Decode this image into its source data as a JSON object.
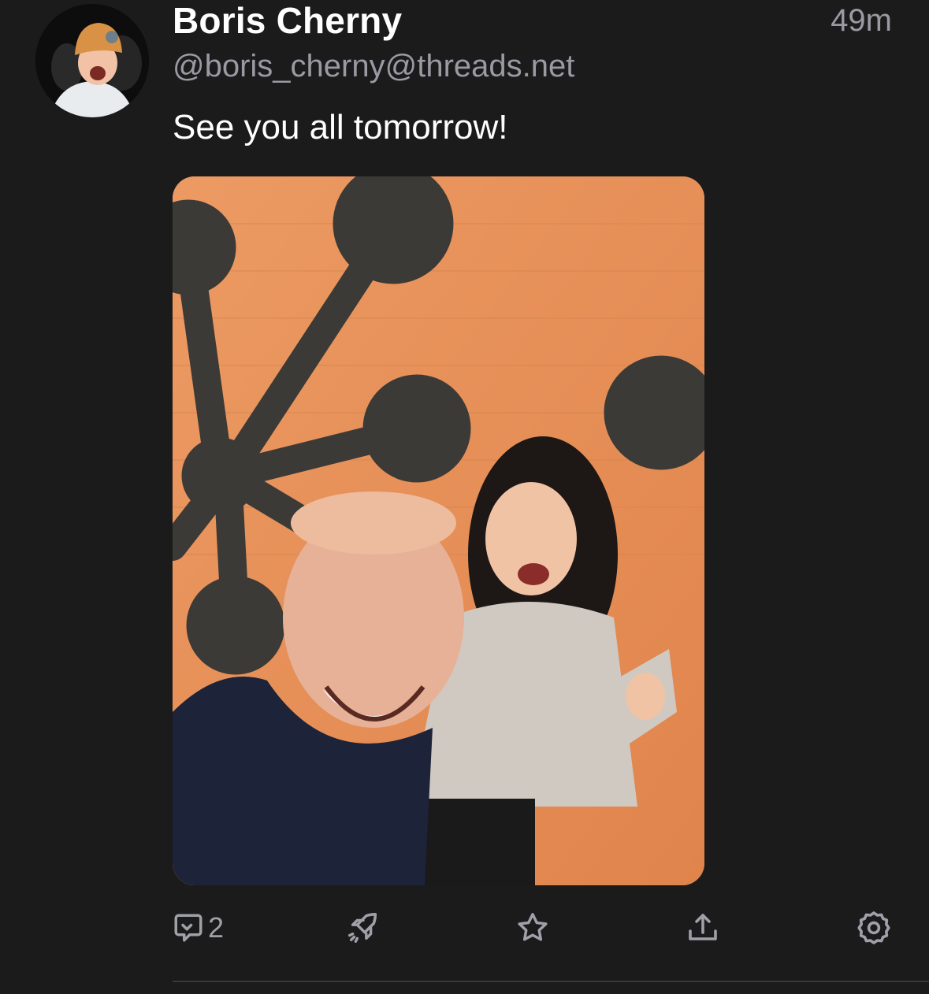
{
  "post": {
    "author_name": "Boris Cherny",
    "author_handle": "@boris_cherny@threads.net",
    "timestamp": "49m",
    "text": "See you all tomorrow!",
    "avatar_icon": "avatar-photo",
    "media_alt": "selfie photo"
  },
  "actions": {
    "reply_icon": "reply-icon",
    "reply_count": "2",
    "boost_icon": "rocket-icon",
    "favorite_icon": "star-icon",
    "share_icon": "share-icon",
    "more_icon": "gear-icon"
  },
  "colors": {
    "background": "#1b1b1c",
    "name": "#ffffff",
    "secondary": "#9a9aa2",
    "media_wall": "#e8935a"
  }
}
